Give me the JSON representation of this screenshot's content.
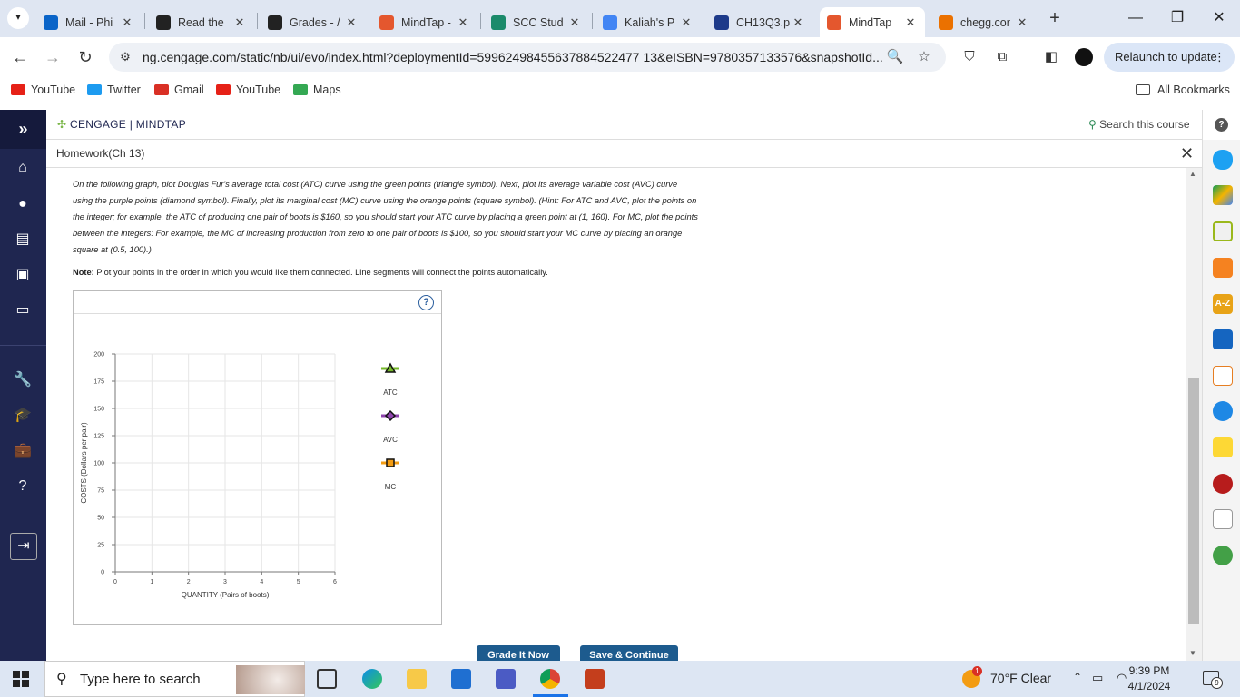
{
  "browser": {
    "tabs": [
      {
        "title": "Mail - Phi",
        "icon": "outlook-icon",
        "color": "#0a64c8"
      },
      {
        "title": "Read the",
        "icon": "d2l-icon",
        "color": "#222"
      },
      {
        "title": "Grades - /",
        "icon": "d2l-icon",
        "color": "#222"
      },
      {
        "title": "MindTap -",
        "icon": "mindtap-icon",
        "color": "#e4572e"
      },
      {
        "title": "SCC Stud",
        "icon": "scc-icon",
        "color": "#1b8a6b"
      },
      {
        "title": "Kaliah's P",
        "icon": "google-icon",
        "color": "#4285f4"
      },
      {
        "title": "CH13Q3.p",
        "icon": "star-doc-icon",
        "color": "#1d3a8a"
      },
      {
        "title": "MindTap",
        "icon": "mindtap-icon",
        "color": "#e4572e"
      },
      {
        "title": "chegg.cor",
        "icon": "chegg-icon",
        "color": "#eb7100"
      }
    ],
    "url": "ng.cengage.com/static/nb/ui/evo/index.html?deploymentId=59962498455637884522477 13&eISBN=9780357133576&snapshotId...",
    "relaunch": "Relaunch to update",
    "bookmarks": [
      {
        "label": "YouTube",
        "color": "#e62117"
      },
      {
        "label": "Twitter",
        "color": "#1d9bf0"
      },
      {
        "label": "Gmail",
        "color": "#d93025"
      },
      {
        "label": "YouTube",
        "color": "#e62117"
      },
      {
        "label": "Maps",
        "color": "#34a853"
      }
    ],
    "all_bookmarks": "All Bookmarks"
  },
  "app": {
    "logo": "CENGAGE | MINDTAP",
    "search": "Search this course",
    "assignment": "Homework(Ch 13)"
  },
  "question": {
    "instructions": "On the following graph, plot Douglas Fur's average total cost (ATC) curve using the green points (triangle symbol). Next, plot its average variable cost (AVC) curve using the purple points (diamond symbol). Finally, plot its marginal cost (MC) curve using the orange points (square symbol). (Hint: For ATC and AVC, plot the points on the integer; for example, the ATC of producing one pair of boots is $160, so you should start your ATC curve by placing a green point at (1, 160). For MC, plot the points between the integers: For example, the MC of increasing production from zero to one pair of boots is $100, so you should start your MC curve by placing an orange square at (0.5, 100).)",
    "note_label": "Note:",
    "note": "Plot your points in the order in which you would like them connected. Line segments will connect the points automatically.",
    "help": "?"
  },
  "chart_data": {
    "type": "scatter",
    "xlabel": "QUANTITY (Pairs of boots)",
    "ylabel": "COSTS (Dollars per pair)",
    "xlim": [
      0,
      6
    ],
    "ylim": [
      0,
      200
    ],
    "xticks": [
      0,
      1,
      2,
      3,
      4,
      5,
      6
    ],
    "yticks": [
      0,
      25,
      50,
      75,
      100,
      125,
      150,
      175,
      200
    ],
    "grid": true,
    "legend": [
      {
        "name": "ATC",
        "marker": "triangle",
        "color": "#76b82a"
      },
      {
        "name": "AVC",
        "marker": "diamond",
        "color": "#8e44ad"
      },
      {
        "name": "MC",
        "marker": "square",
        "color": "#f39c12"
      }
    ],
    "series": []
  },
  "buttons": {
    "grade": "Grade It Now",
    "save": "Save & Continue"
  },
  "taskbar": {
    "search_placeholder": "Type here to search",
    "weather": "70°F  Clear",
    "weather_badge": "1",
    "time": "9:39 PM",
    "date": "4/1/2024",
    "notif_count": "9"
  }
}
